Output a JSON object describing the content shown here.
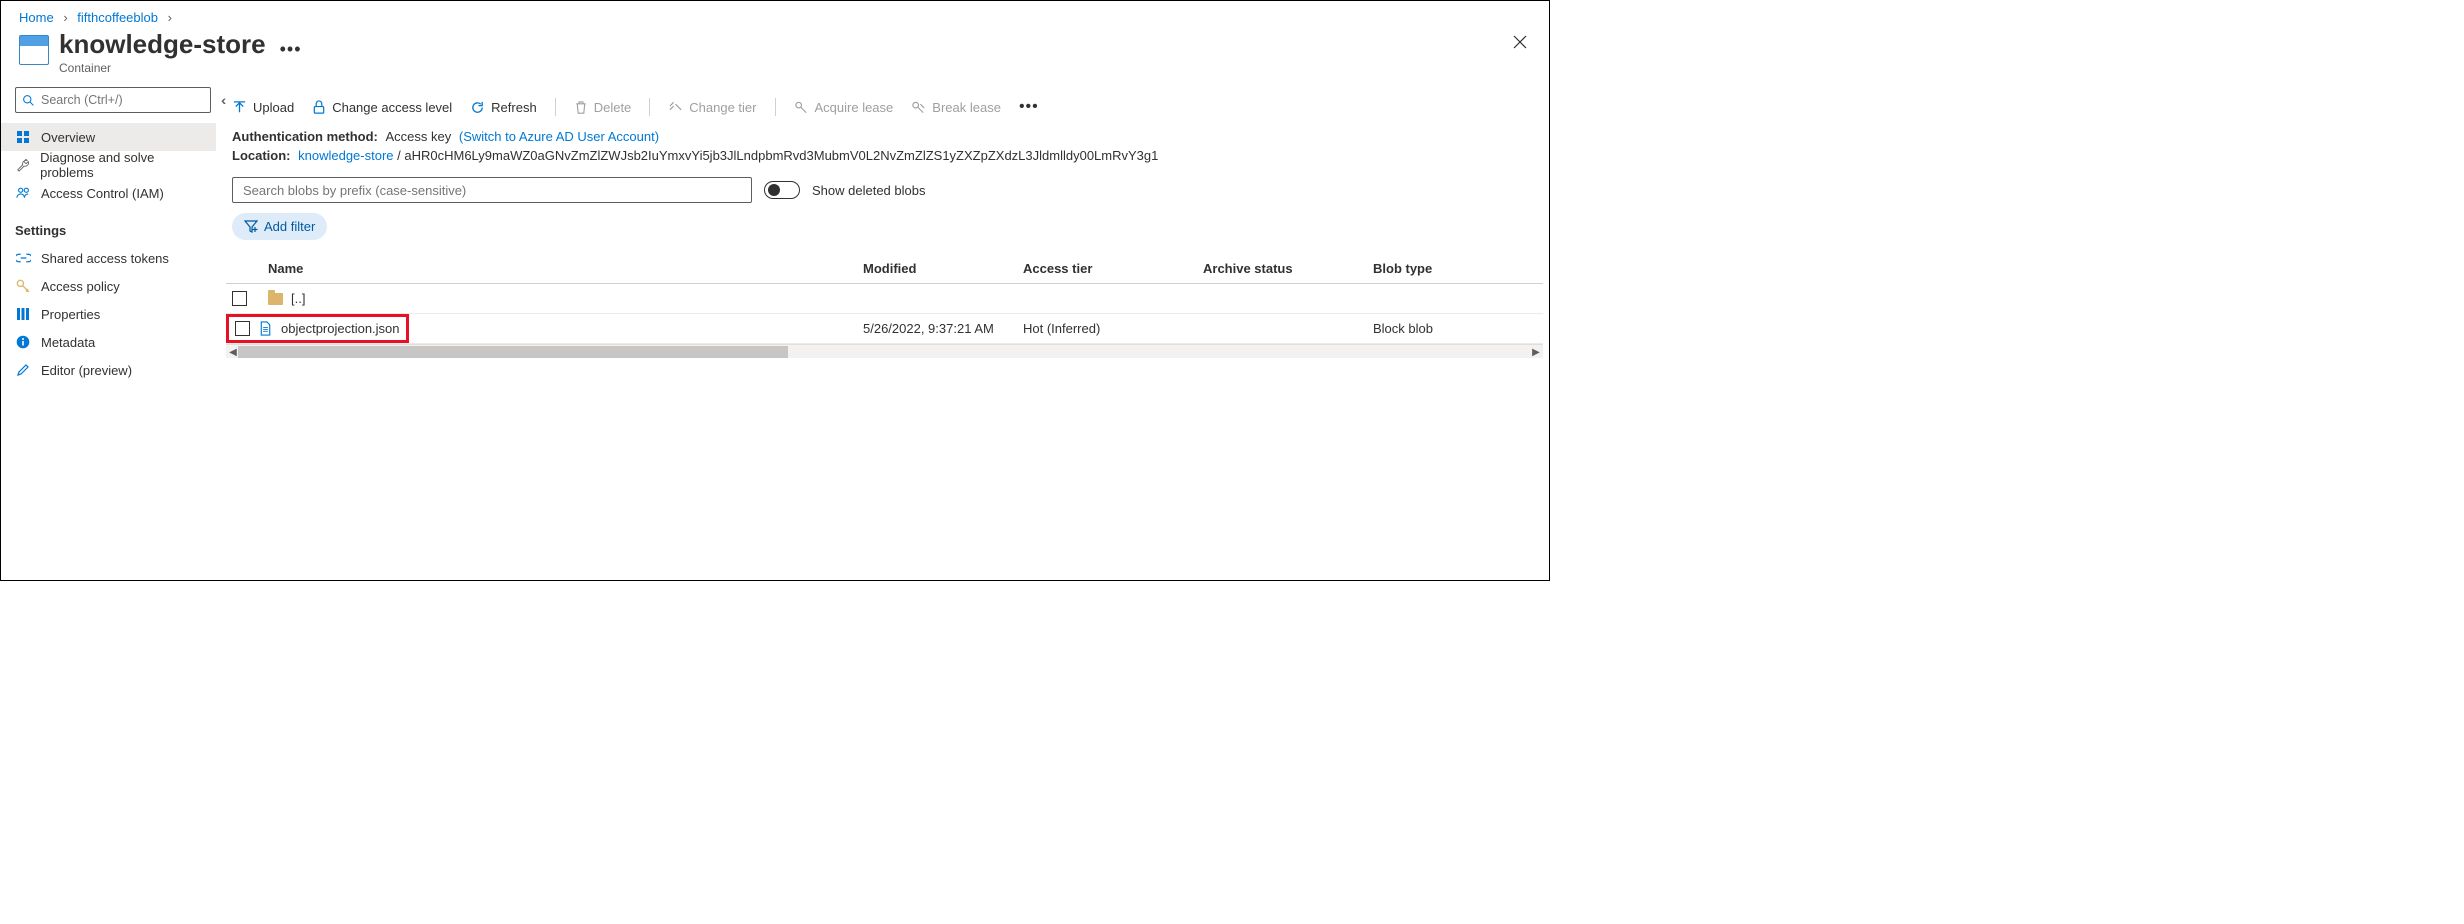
{
  "breadcrumb": {
    "home": "Home",
    "parent": "fifthcoffeeblob"
  },
  "header": {
    "title": "knowledge-store",
    "subtitle": "Container"
  },
  "sidebar": {
    "searchPlaceholder": "Search (Ctrl+/)",
    "items": {
      "overview": "Overview",
      "diagnose": "Diagnose and solve problems",
      "iam": "Access Control (IAM)"
    },
    "settingsHeading": "Settings",
    "settings": {
      "sas": "Shared access tokens",
      "policy": "Access policy",
      "properties": "Properties",
      "metadata": "Metadata",
      "editor": "Editor (preview)"
    }
  },
  "commands": {
    "upload": "Upload",
    "changeAccess": "Change access level",
    "refresh": "Refresh",
    "delete": "Delete",
    "changeTier": "Change tier",
    "acquireLease": "Acquire lease",
    "breakLease": "Break lease"
  },
  "auth": {
    "label": "Authentication method:",
    "value": "Access key",
    "switchLink": "(Switch to Azure AD User Account)"
  },
  "location": {
    "label": "Location:",
    "container": "knowledge-store",
    "sep": " / ",
    "path": "aHR0cHM6Ly9maWZ0aGNvZmZlZWJsb2IuYmxvYi5jb3JlLndpbmRvd3MubmV0L2NvZmZlZS1yZXZpZXdzL3Jldmlldy00LmRvY3g1"
  },
  "filter": {
    "prefixPlaceholder": "Search blobs by prefix (case-sensitive)",
    "showDeleted": "Show deleted blobs",
    "addFilter": "Add filter"
  },
  "table": {
    "cols": {
      "name": "Name",
      "modified": "Modified",
      "tier": "Access tier",
      "archive": "Archive status",
      "blobtype": "Blob type"
    },
    "parentDir": "[..]",
    "row1": {
      "name": "objectprojection.json",
      "modified": "5/26/2022, 9:37:21 AM",
      "tier": "Hot (Inferred)",
      "archive": "",
      "blobtype": "Block blob"
    }
  }
}
